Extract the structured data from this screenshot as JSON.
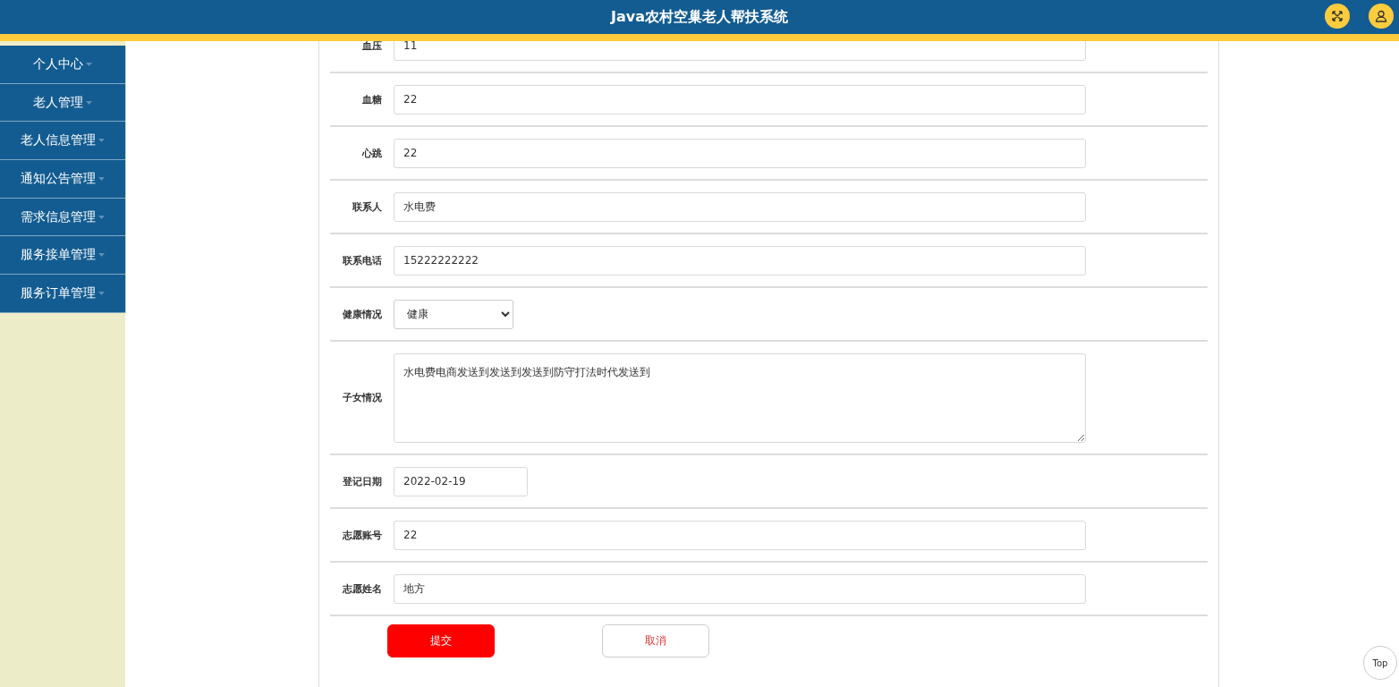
{
  "header": {
    "title": "Java农村空巢老人帮扶系统"
  },
  "sidebar": {
    "items": [
      {
        "label": "个人中心"
      },
      {
        "label": "老人管理"
      },
      {
        "label": "老人信息管理"
      },
      {
        "label": "通知公告管理"
      },
      {
        "label": "需求信息管理"
      },
      {
        "label": "服务接单管理"
      },
      {
        "label": "服务订单管理"
      }
    ]
  },
  "form": {
    "fields": [
      {
        "kind": "text",
        "label": "血压",
        "value": "11"
      },
      {
        "kind": "text",
        "label": "血糖",
        "value": "22"
      },
      {
        "kind": "text",
        "label": "心跳",
        "value": "22"
      },
      {
        "kind": "text",
        "label": "联系人",
        "value": "水电费"
      },
      {
        "kind": "text",
        "label": "联系电话",
        "value": "15222222222"
      },
      {
        "kind": "select",
        "label": "健康情况",
        "value": "健康"
      },
      {
        "kind": "textarea",
        "label": "子女情况",
        "value": "水电费电商发送到发送到发送到防守打法时代发送到"
      },
      {
        "kind": "date",
        "label": "登记日期",
        "value": "2022-02-19"
      },
      {
        "kind": "text",
        "label": "志愿账号",
        "value": "22"
      },
      {
        "kind": "text",
        "label": "志愿姓名",
        "value": "地方"
      }
    ],
    "buttons": [
      {
        "kind": "primary",
        "label": "提交"
      },
      {
        "kind": "secondary",
        "label": "取消"
      }
    ]
  },
  "back_to_top": "Top"
}
